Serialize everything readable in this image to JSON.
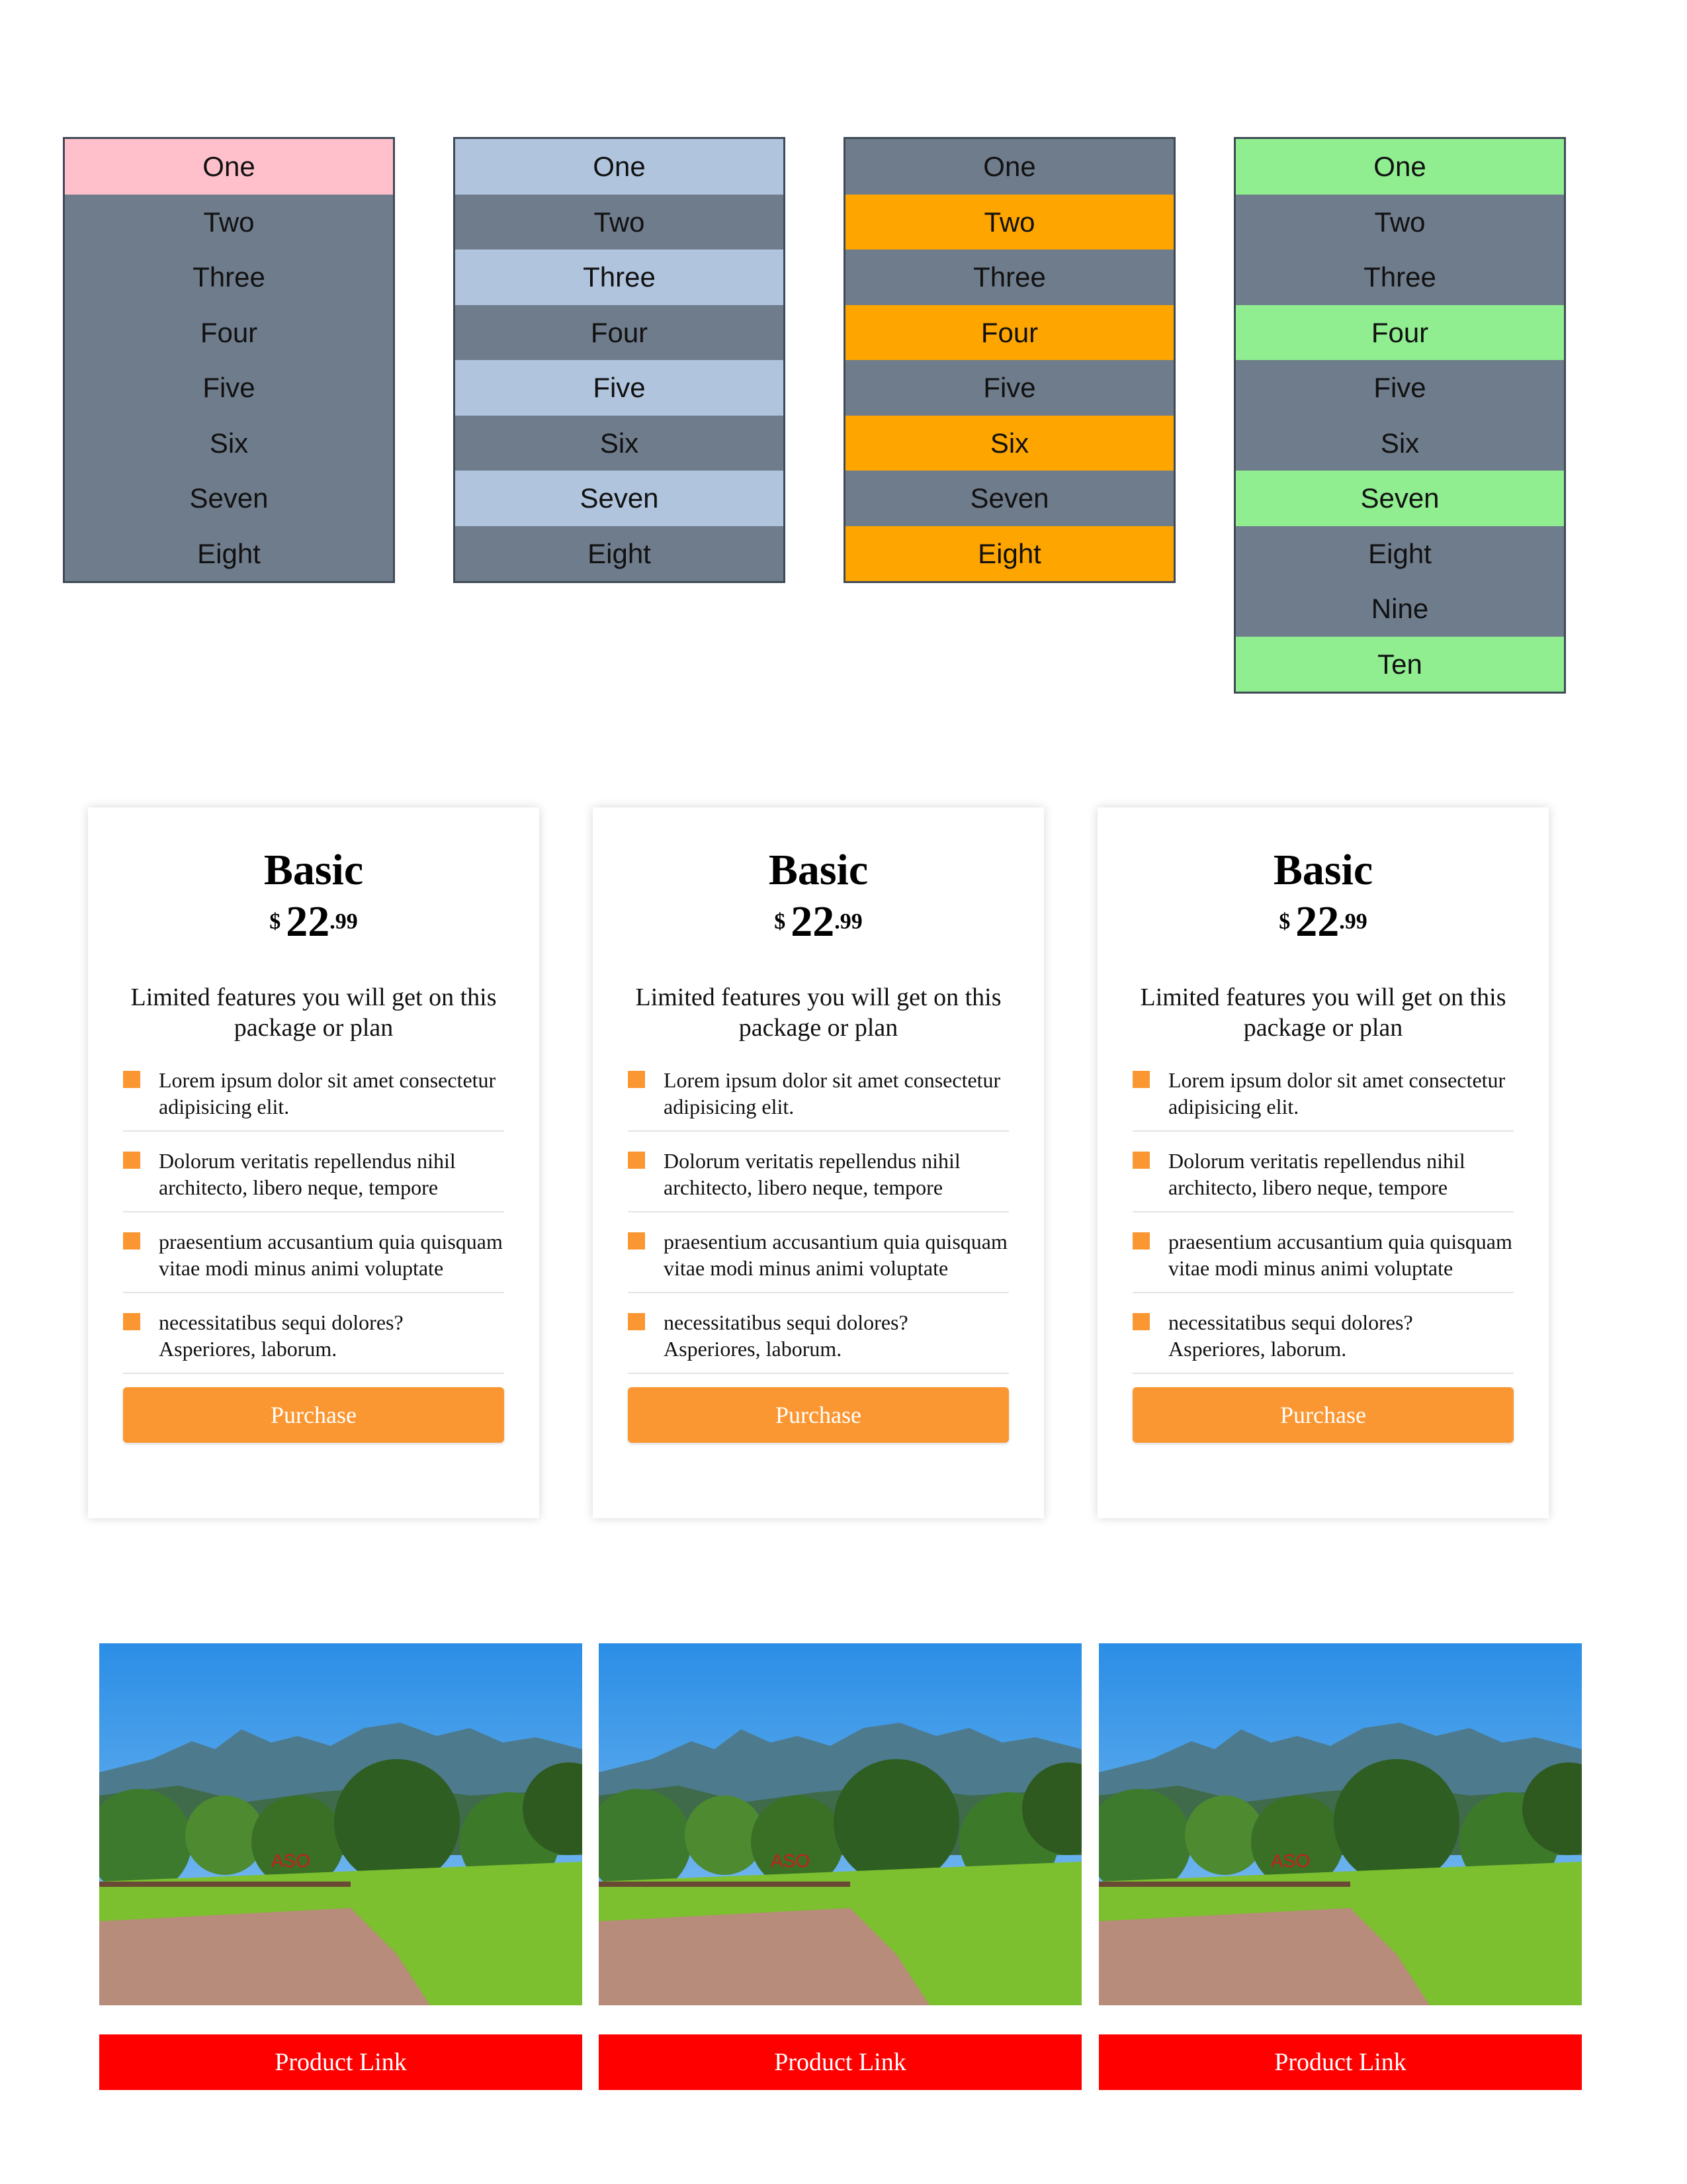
{
  "lists": [
    {
      "items": [
        "One",
        "Two",
        "Three",
        "Four",
        "Five",
        "Six",
        "Seven",
        "Eight"
      ],
      "highlight_color": "#ffc0cb",
      "highlight_indices": [
        0
      ]
    },
    {
      "items": [
        "One",
        "Two",
        "Three",
        "Four",
        "Five",
        "Six",
        "Seven",
        "Eight"
      ],
      "highlight_color": "#b0c4de",
      "highlight_indices": [
        0,
        2,
        4,
        6
      ]
    },
    {
      "items": [
        "One",
        "Two",
        "Three",
        "Four",
        "Five",
        "Six",
        "Seven",
        "Eight"
      ],
      "highlight_color": "#ffa500",
      "highlight_indices": [
        1,
        3,
        5,
        7
      ]
    },
    {
      "items": [
        "One",
        "Two",
        "Three",
        "Four",
        "Five",
        "Six",
        "Seven",
        "Eight",
        "Nine",
        "Ten"
      ],
      "highlight_color": "#90ee90",
      "highlight_indices": [
        0,
        3,
        6,
        9
      ]
    }
  ],
  "list_base_color": "#6f7c8c",
  "pricing": {
    "accent": "#fb9732",
    "cards": [
      {
        "title": "Basic",
        "currency": "$",
        "amount": "22",
        "cents": ".99",
        "description": "Limited features you will get on this package or plan",
        "features": [
          "Lorem ipsum dolor sit amet consectetur adipisicing elit.",
          "Dolorum veritatis repellendus nihil architecto, libero neque, tempore",
          "praesentium accusantium quia quisquam vitae modi minus animi voluptate",
          "necessitatibus sequi dolores? Asperiores, laborum."
        ],
        "button": "Purchase"
      },
      {
        "title": "Basic",
        "currency": "$",
        "amount": "22",
        "cents": ".99",
        "description": "Limited features you will get on this package or plan",
        "features": [
          "Lorem ipsum dolor sit amet consectetur adipisicing elit.",
          "Dolorum veritatis repellendus nihil architecto, libero neque, tempore",
          "praesentium accusantium quia quisquam vitae modi minus animi voluptate",
          "necessitatibus sequi dolores? Asperiores, laborum."
        ],
        "button": "Purchase"
      },
      {
        "title": "Basic",
        "currency": "$",
        "amount": "22",
        "cents": ".99",
        "description": "Limited features you will get on this package or plan",
        "features": [
          "Lorem ipsum dolor sit amet consectetur adipisicing elit.",
          "Dolorum veritatis repellendus nihil architecto, libero neque, tempore",
          "praesentium accusantium quia quisquam vitae modi minus animi voluptate",
          "necessitatibus sequi dolores? Asperiores, laborum."
        ],
        "button": "Purchase"
      }
    ]
  },
  "products": {
    "link_color": "#ff0000",
    "items": [
      {
        "link_label": "Product Link",
        "image_text": "ASO"
      },
      {
        "link_label": "Product Link",
        "image_text": "ASO"
      },
      {
        "link_label": "Product Link",
        "image_text": "ASO"
      }
    ]
  }
}
